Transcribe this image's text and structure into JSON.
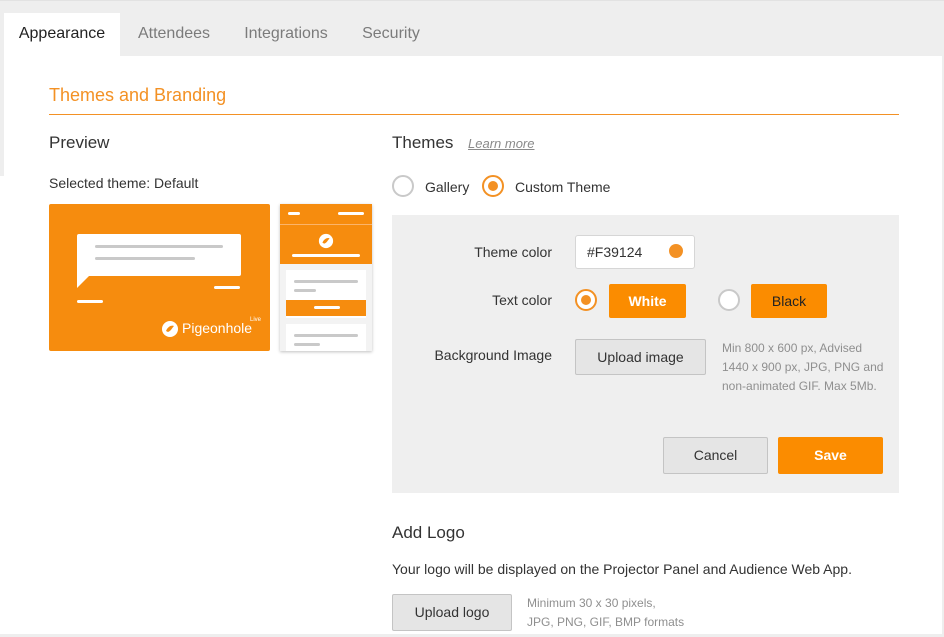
{
  "tabs": [
    {
      "label": "Appearance",
      "active": true
    },
    {
      "label": "Attendees",
      "active": false
    },
    {
      "label": "Integrations",
      "active": false
    },
    {
      "label": "Security",
      "active": false
    }
  ],
  "section": {
    "title": "Themes and Branding"
  },
  "preview": {
    "heading": "Preview",
    "selected_theme": "Selected theme: Default",
    "brand": "Pigeonhole",
    "brand_sup": "Live"
  },
  "themes": {
    "heading": "Themes",
    "learn_more": "Learn more",
    "options": [
      {
        "label": "Gallery",
        "selected": false
      },
      {
        "label": "Custom Theme",
        "selected": true
      }
    ]
  },
  "custom": {
    "theme_color_label": "Theme color",
    "theme_color_value": "#F39124",
    "text_color_label": "Text color",
    "text_color_options": [
      {
        "label": "White",
        "selected": true
      },
      {
        "label": "Black",
        "selected": false
      }
    ],
    "background_label": "Background Image",
    "upload_image_label": "Upload image",
    "background_hint": [
      "Min 800 x 600 px, Advised",
      "1440 x 900 px, JPG, PNG and",
      "non-animated GIF. Max 5Mb."
    ],
    "cancel_label": "Cancel",
    "save_label": "Save"
  },
  "logo": {
    "heading": "Add Logo",
    "description": "Your logo will be displayed on the Projector Panel and Audience Web App.",
    "upload_label": "Upload logo",
    "hint": [
      "Minimum 30 x 30 pixels,",
      "JPG, PNG, GIF, BMP formats"
    ]
  },
  "colors": {
    "accent": "#F39124",
    "button_orange": "#FB8C00",
    "panel_bg": "#EFEFEF"
  }
}
